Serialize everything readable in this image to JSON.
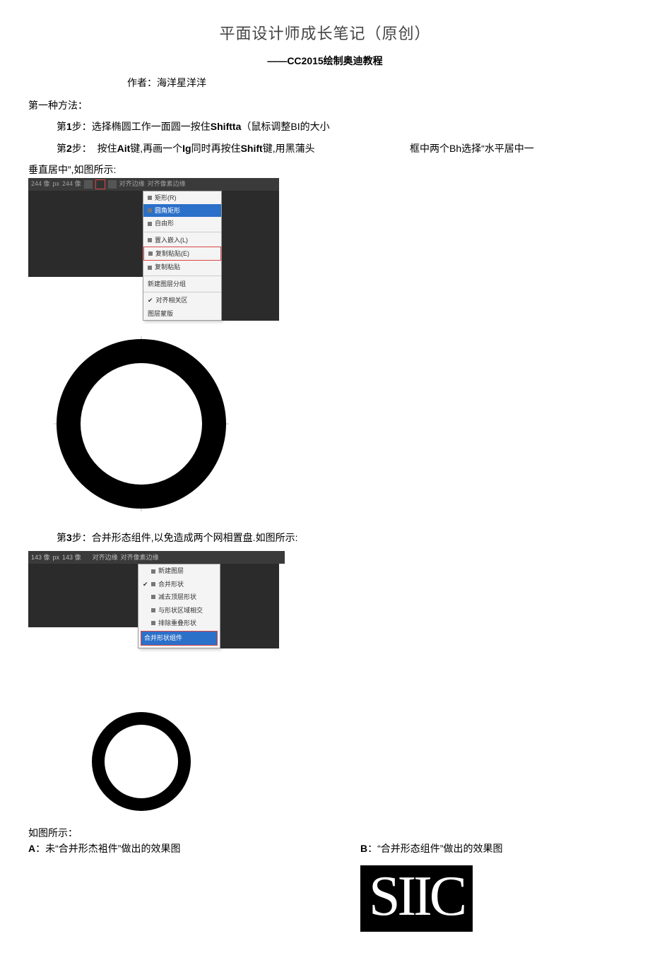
{
  "title": "平面设计师成长笔记（原创）",
  "subtitle": "——CC2015绘制奥迪教程",
  "author_label": "作者：海洋星洋洋",
  "method_label": "第一种方法：",
  "step1": {
    "prefix": "第",
    "num": "1",
    "suffix": "步：选择椭圆工作一面圆一按住",
    "kw": "Shiftta",
    "tail": "（鼠标调整BI的大小"
  },
  "step2": {
    "prefix": "第",
    "num": "2",
    "suffix": "步：",
    "body1": "按住",
    "kw1": "Ait",
    "body2": "键,再画一个",
    "kw2": "Ig",
    "body3": "同时再按住",
    "kw3": "Shift",
    "body4": "键,用黑蒲头",
    "right": "框中两个Bh选择“水平居中一"
  },
  "step2_tail": "垂直居中”,如图所示:",
  "toolbar1": {
    "dims1": "244 像",
    "px": "px",
    "dims2": "244 像",
    "icon": "■",
    "opt1": "对齐边缘",
    "opt2": "对齐像素边缘"
  },
  "ctx1": {
    "items": [
      "矩形(R)",
      "圆角矩形",
      "自由形",
      "置入嵌入(L)",
      "复制粘贴(E)",
      "复制粘贴",
      "新建图层分组",
      "对齐相关区",
      "图层蒙版"
    ]
  },
  "step3": {
    "prefix": "第",
    "num": "3",
    "suffix": "步：合并形态组件,以免造成两个网相置盘.如图所示:"
  },
  "toolbar2": {
    "dims1": "143 像",
    "px": "px",
    "dims2": "143 像",
    "opt1": "对齐边缘",
    "opt2": "对齐像素边缘"
  },
  "ctx2": {
    "items": [
      "新建图层",
      "合并形状",
      "减去顶层形状",
      "与形状区域相交",
      "排除重叠形状"
    ],
    "sel": "合并形状组件"
  },
  "note": "如图所示：",
  "colA": {
    "prefix": "A",
    "text": "：未“合并形杰袓件”做出的效果图"
  },
  "colB": {
    "prefix": "B",
    "text": "：“合并形态组件”做出的效果图"
  },
  "siic": "SIIC"
}
